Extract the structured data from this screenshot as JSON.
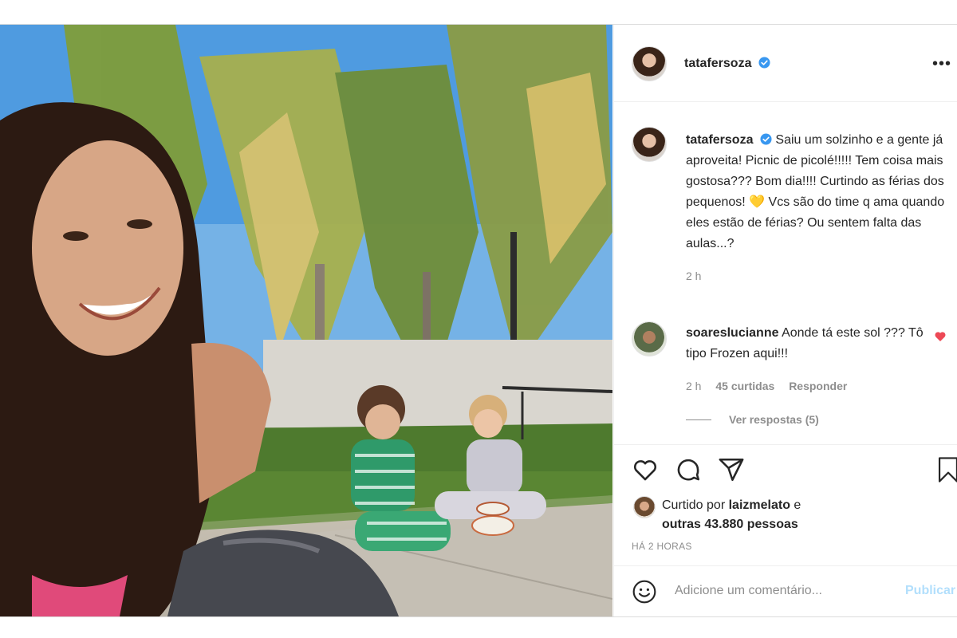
{
  "post": {
    "username": "tatafersoza",
    "caption": "Saiu um solzinho e a gente já aproveita! Picnic de picolé!!!!! Tem coisa mais gostosa??? Bom dia!!!! Curtindo as férias dos pequenos! 💛 Vcs são do time q ama quando eles estão de férias? Ou sentem falta das aulas...?",
    "caption_time": "2 h"
  },
  "comment": {
    "username": "soareslucianne",
    "text": "Aonde tá este sol ??? Tô tipo Frozen aqui!!!",
    "time": "2 h",
    "likes": "45 curtidas",
    "reply_label": "Responder",
    "view_replies": "Ver respostas (5)"
  },
  "likes": {
    "prefix": "Curtido por",
    "user": "laizmelato",
    "connector": "e",
    "others": "outras 43.880 pessoas"
  },
  "timestamp": "HÁ 2 HORAS",
  "comment_bar": {
    "placeholder": "Adicione um comentário...",
    "publish_label": "Publicar"
  },
  "colors": {
    "verified": "#3897f0",
    "heart": "#ed4956",
    "publish": "#b2dffc"
  },
  "icons": [
    "more-icon",
    "verified-icon",
    "heart-icon",
    "comment-icon",
    "share-icon",
    "bookmark-icon",
    "emoji-icon"
  ]
}
